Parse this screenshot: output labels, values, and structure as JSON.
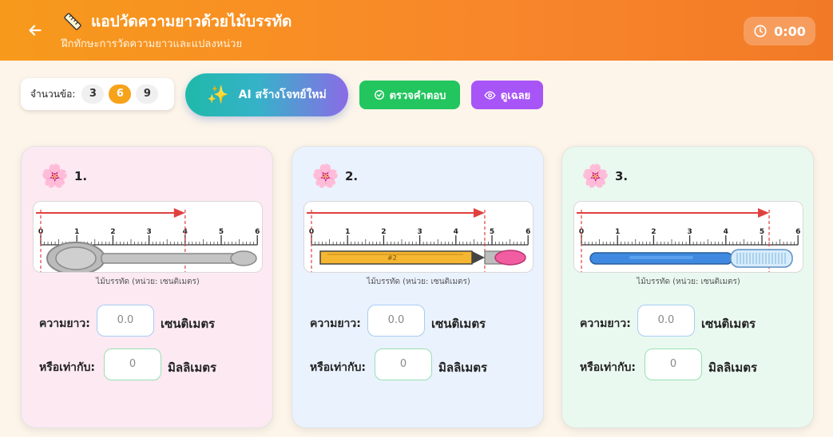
{
  "header": {
    "title": "แอปวัดความยาวด้วยไม้บรรทัด",
    "subtitle": "ฝึกทักษะการวัดความยาวและแปลงหน่วย",
    "timer": "0:00",
    "back_icon": "arrow-left-icon",
    "title_icon": "ruler-icon",
    "timer_icon": "clock-icon"
  },
  "toolbar": {
    "count_label": "จำนวนข้อ:",
    "count_options": [
      "3",
      "6",
      "9"
    ],
    "count_selected": "6",
    "ai_button": "AI สร้างโจทย์ใหม่",
    "check_button": "ตรวจคำตอบ",
    "answer_button": "ดูเฉลย"
  },
  "questions": [
    {
      "number": "1.",
      "object": "spoon",
      "ruler_ticks": [
        "0",
        "1",
        "2",
        "3",
        "4",
        "5",
        "6"
      ],
      "measured_cm": 4,
      "caption": "ไม้บรรทัด (หน่วย: เซนติเมตร)",
      "length_label": "ความยาว:",
      "cm_placeholder": "0.0",
      "cm_unit": "เซนติเมตร",
      "mm_label": "หรือเท่ากับ:",
      "mm_placeholder": "0",
      "mm_unit": "มิลลิเมตร"
    },
    {
      "number": "2.",
      "object": "pencil",
      "pencil_label": "#2",
      "ruler_ticks": [
        "0",
        "1",
        "2",
        "3",
        "4",
        "5",
        "6"
      ],
      "measured_cm": 4.8,
      "caption": "ไม้บรรทัด (หน่วย: เซนติเมตร)",
      "length_label": "ความยาว:",
      "cm_placeholder": "0.0",
      "cm_unit": "เซนติเมตร",
      "mm_label": "หรือเท่ากับ:",
      "mm_placeholder": "0",
      "mm_unit": "มิลลิเมตร"
    },
    {
      "number": "3.",
      "object": "toothbrush",
      "ruler_ticks": [
        "0",
        "1",
        "2",
        "3",
        "4",
        "5",
        "6"
      ],
      "measured_cm": 5.2,
      "caption": "ไม้บรรทัด (หน่วย: เซนติเมตร)",
      "length_label": "ความยาว:",
      "cm_placeholder": "0.0",
      "cm_unit": "เซนติเมตร",
      "mm_label": "หรือเท่ากับ:",
      "mm_placeholder": "0",
      "mm_unit": "มิลลิเมตร"
    }
  ]
}
